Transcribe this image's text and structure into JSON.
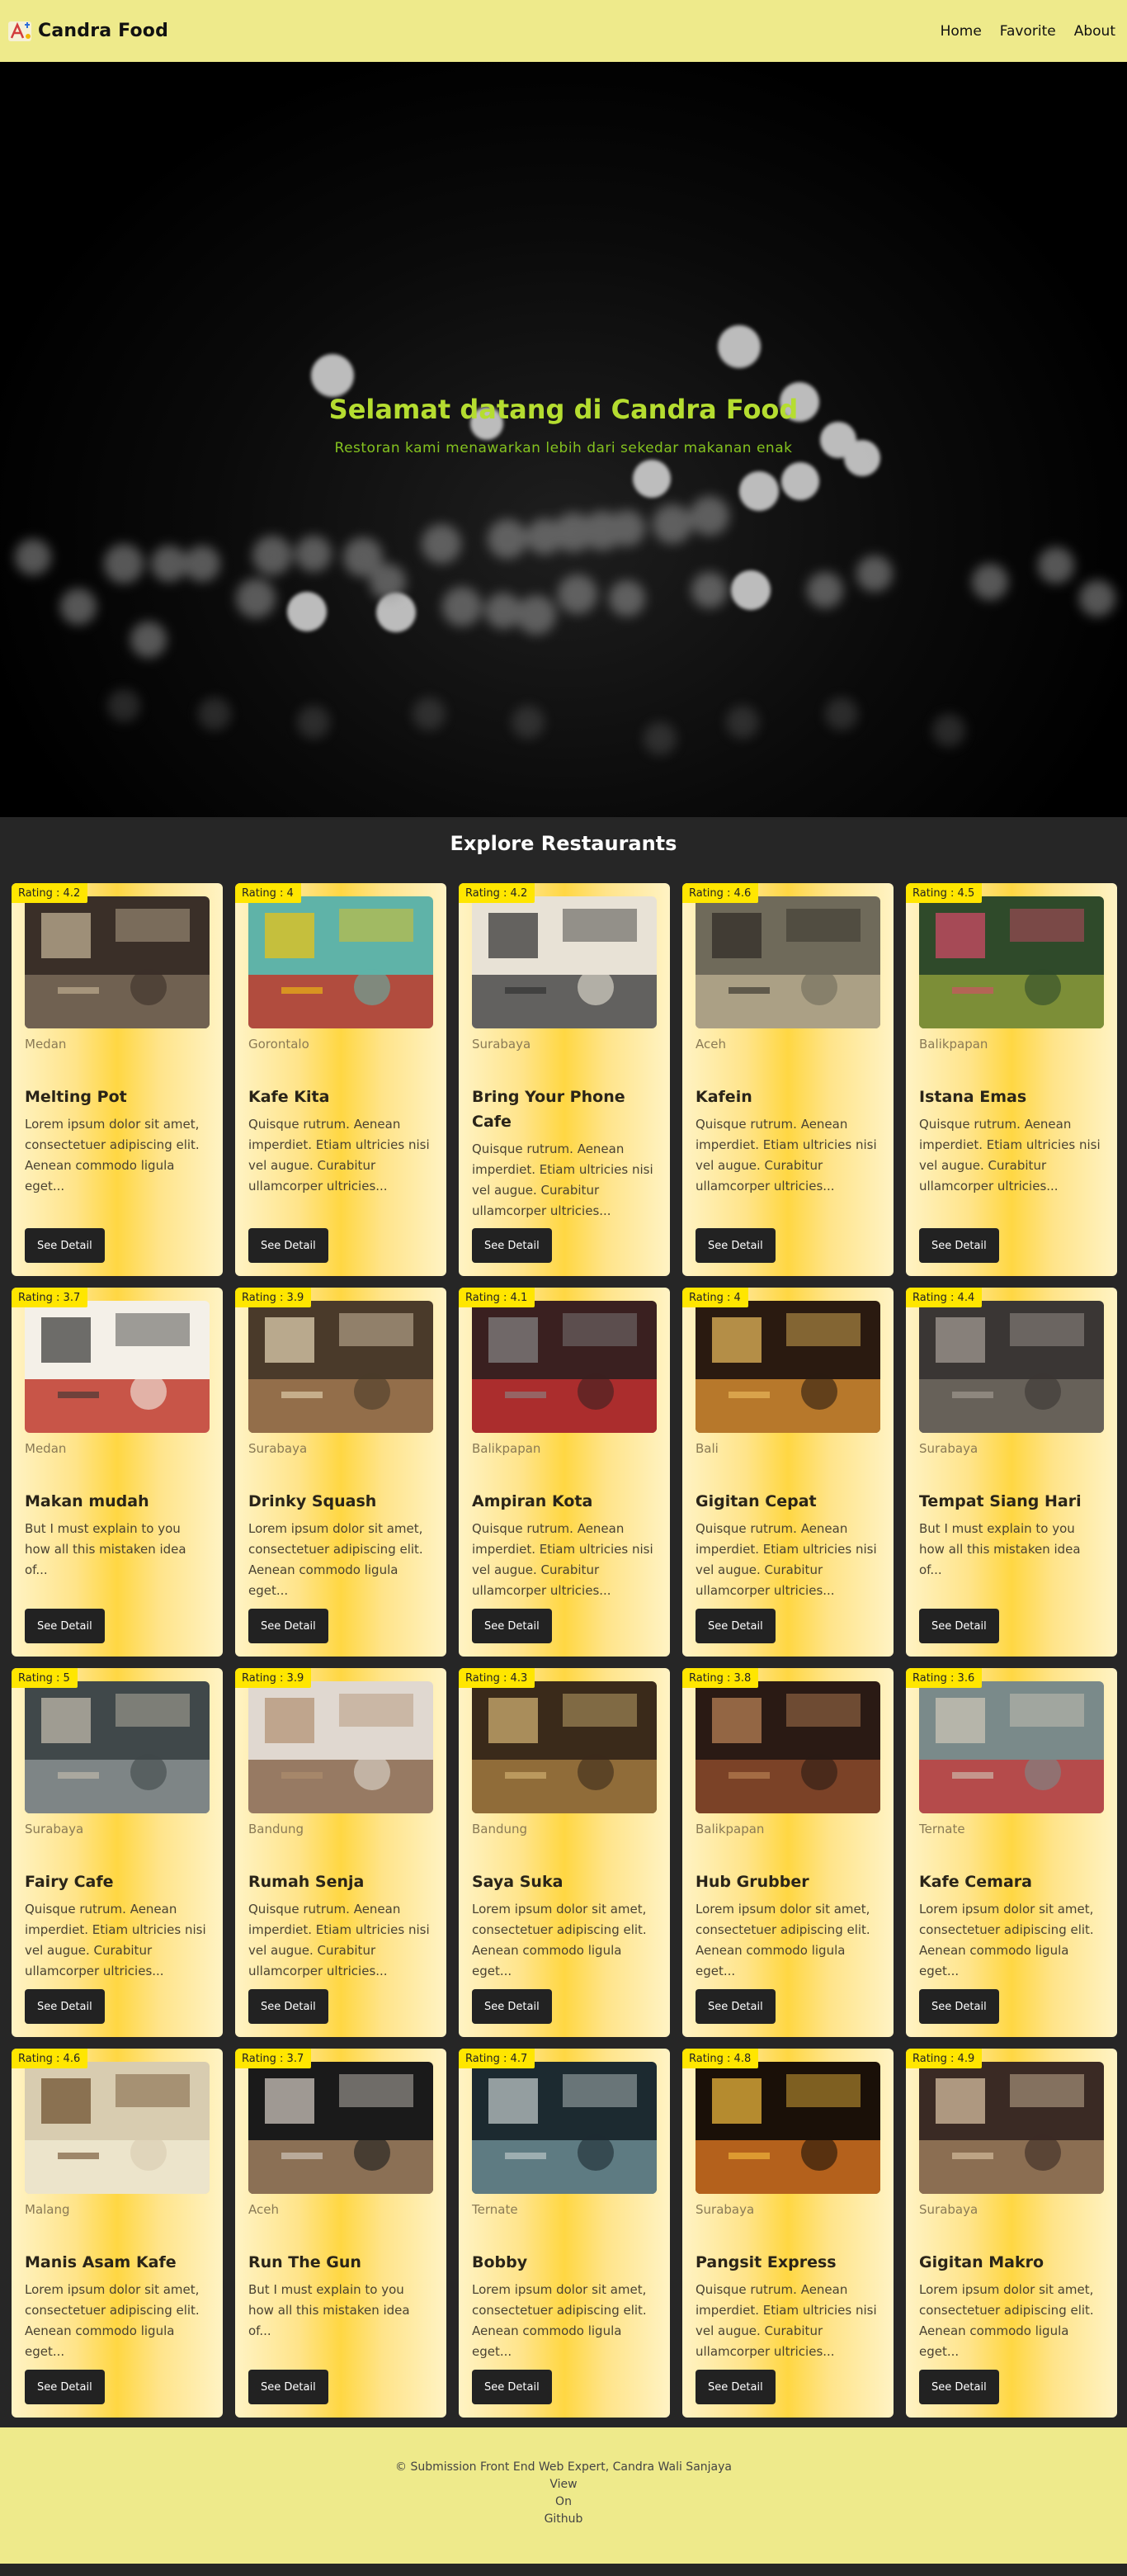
{
  "header": {
    "brand": "Candra Food",
    "logo_icon": "logo-icon",
    "nav": [
      {
        "label": "Home"
      },
      {
        "label": "Favorite"
      },
      {
        "label": "About"
      }
    ]
  },
  "hero": {
    "title": "Selamat datang di Candra Food",
    "subtitle": "Restoran kami menawarkan lebih dari sekedar makanan enak"
  },
  "explore": {
    "title": "Explore Restaurants",
    "button_label": "See Detail",
    "restaurants": [
      {
        "rating": "Rating : 4.2",
        "city": "Medan",
        "name": "Melting Pot",
        "description": "Lorem ipsum dolor sit amet, consectetuer adipiscing elit. Aenean commodo ligula eget..."
      },
      {
        "rating": "Rating : 4",
        "city": "Gorontalo",
        "name": "Kafe Kita",
        "description": "Quisque rutrum. Aenean imperdiet. Etiam ultricies nisi vel augue. Curabitur ullamcorper ultricies..."
      },
      {
        "rating": "Rating : 4.2",
        "city": "Surabaya",
        "name": "Bring Your Phone Cafe",
        "description": "Quisque rutrum. Aenean imperdiet. Etiam ultricies nisi vel augue. Curabitur ullamcorper ultricies..."
      },
      {
        "rating": "Rating : 4.6",
        "city": "Aceh",
        "name": "Kafein",
        "description": "Quisque rutrum. Aenean imperdiet. Etiam ultricies nisi vel augue. Curabitur ullamcorper ultricies..."
      },
      {
        "rating": "Rating : 4.5",
        "city": "Balikpapan",
        "name": "Istana Emas",
        "description": "Quisque rutrum. Aenean imperdiet. Etiam ultricies nisi vel augue. Curabitur ullamcorper ultricies..."
      },
      {
        "rating": "Rating : 3.7",
        "city": "Medan",
        "name": "Makan mudah",
        "description": "But I must explain to you how all this mistaken idea of..."
      },
      {
        "rating": "Rating : 3.9",
        "city": "Surabaya",
        "name": "Drinky Squash",
        "description": "Lorem ipsum dolor sit amet, consectetuer adipiscing elit. Aenean commodo ligula eget..."
      },
      {
        "rating": "Rating : 4.1",
        "city": "Balikpapan",
        "name": "Ampiran Kota",
        "description": "Quisque rutrum. Aenean imperdiet. Etiam ultricies nisi vel augue. Curabitur ullamcorper ultricies..."
      },
      {
        "rating": "Rating : 4",
        "city": "Bali",
        "name": "Gigitan Cepat",
        "description": "Quisque rutrum. Aenean imperdiet. Etiam ultricies nisi vel augue. Curabitur ullamcorper ultricies..."
      },
      {
        "rating": "Rating : 4.4",
        "city": "Surabaya",
        "name": "Tempat Siang Hari",
        "description": "But I must explain to you how all this mistaken idea of..."
      },
      {
        "rating": "Rating : 5",
        "city": "Surabaya",
        "name": "Fairy Cafe",
        "description": "Quisque rutrum. Aenean imperdiet. Etiam ultricies nisi vel augue. Curabitur ullamcorper ultricies..."
      },
      {
        "rating": "Rating : 3.9",
        "city": "Bandung",
        "name": "Rumah Senja",
        "description": "Quisque rutrum. Aenean imperdiet. Etiam ultricies nisi vel augue. Curabitur ullamcorper ultricies..."
      },
      {
        "rating": "Rating : 4.3",
        "city": "Bandung",
        "name": "Saya Suka",
        "description": "Lorem ipsum dolor sit amet, consectetuer adipiscing elit. Aenean commodo ligula eget..."
      },
      {
        "rating": "Rating : 3.8",
        "city": "Balikpapan",
        "name": "Hub Grubber",
        "description": "Lorem ipsum dolor sit amet, consectetuer adipiscing elit. Aenean commodo ligula eget..."
      },
      {
        "rating": "Rating : 3.6",
        "city": "Ternate",
        "name": "Kafe Cemara",
        "description": "Lorem ipsum dolor sit amet, consectetuer adipiscing elit. Aenean commodo ligula eget..."
      },
      {
        "rating": "Rating : 4.6",
        "city": "Malang",
        "name": "Manis Asam Kafe",
        "description": "Lorem ipsum dolor sit amet, consectetuer adipiscing elit. Aenean commodo ligula eget..."
      },
      {
        "rating": "Rating : 3.7",
        "city": "Aceh",
        "name": "Run The Gun",
        "description": "But I must explain to you how all this mistaken idea of..."
      },
      {
        "rating": "Rating : 4.7",
        "city": "Ternate",
        "name": "Bobby",
        "description": "Lorem ipsum dolor sit amet, consectetuer adipiscing elit. Aenean commodo ligula eget..."
      },
      {
        "rating": "Rating : 4.8",
        "city": "Surabaya",
        "name": "Pangsit Express",
        "description": "Quisque rutrum. Aenean imperdiet. Etiam ultricies nisi vel augue. Curabitur ullamcorper ultricies..."
      },
      {
        "rating": "Rating : 4.9",
        "city": "Surabaya",
        "name": "Gigitan Makro",
        "description": "Lorem ipsum dolor sit amet, consectetuer adipiscing elit. Aenean commodo ligula eget..."
      }
    ]
  },
  "footer": {
    "copyright": "© Submission Front End Web Expert, Candra Wali Sanjaya",
    "link_lines": [
      "View",
      "On",
      "Github"
    ]
  },
  "colors": {
    "header_bg": "#eeea8b",
    "hero_title": "#b5dd30",
    "hero_subtitle": "#84c21f",
    "section_bg": "#262626",
    "rating_badge": "#ffe600",
    "button_bg": "#222222"
  }
}
